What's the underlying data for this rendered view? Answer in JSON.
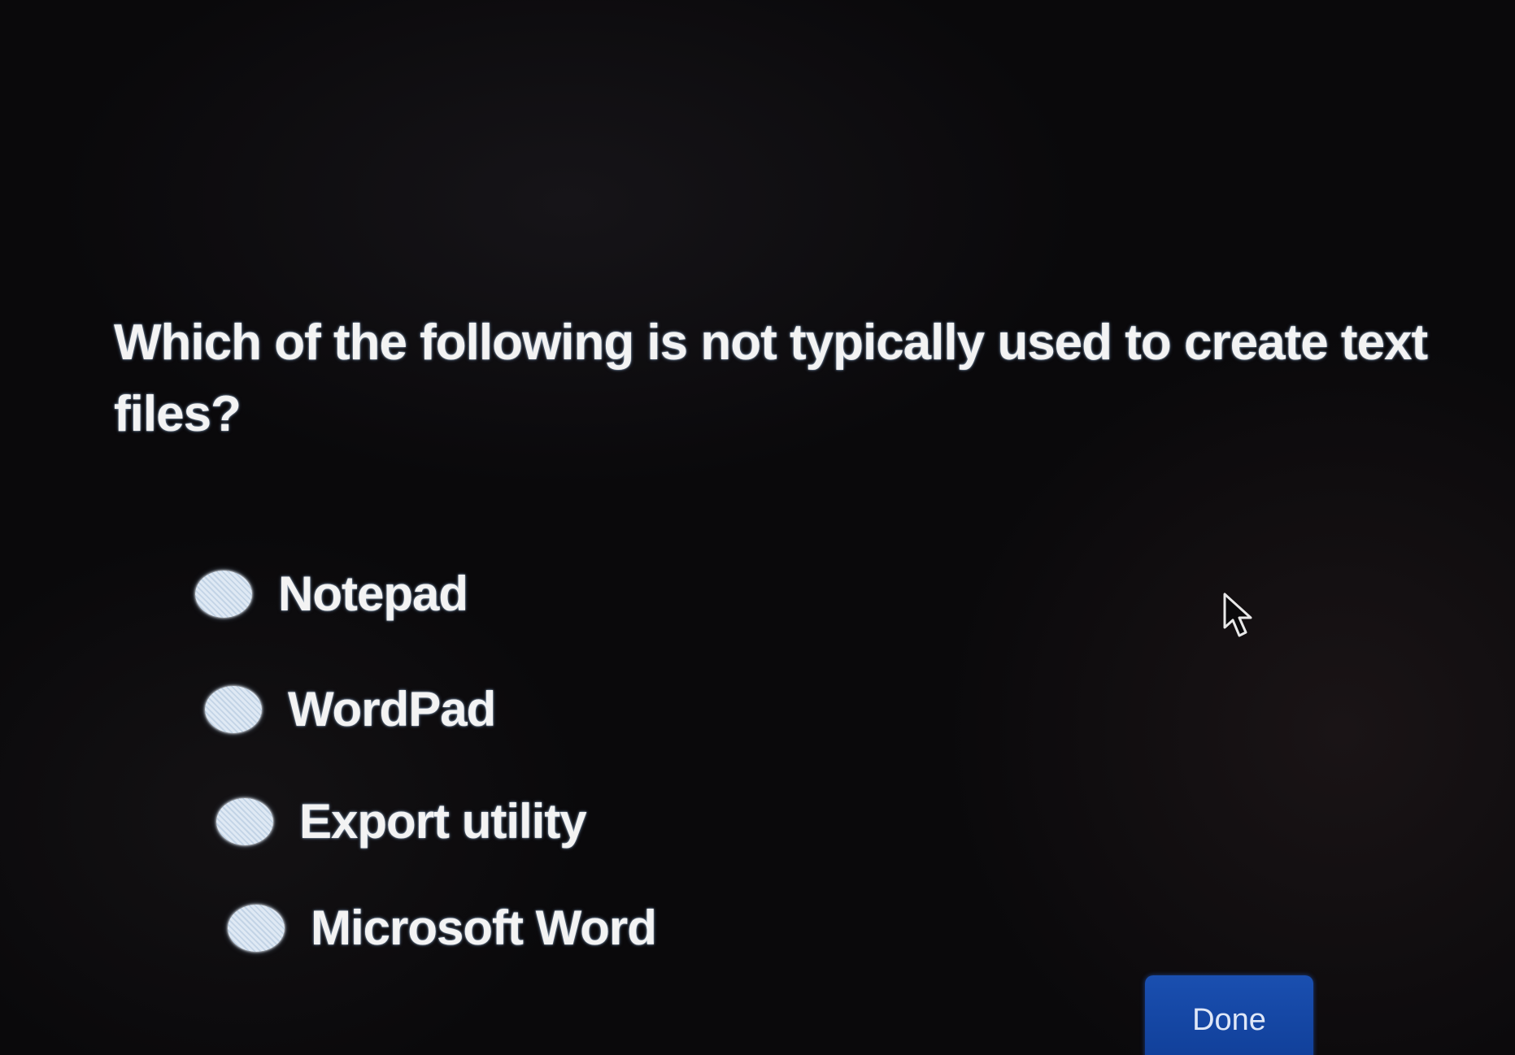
{
  "quiz": {
    "question": "Which of the following is not typically used to create text files?",
    "options": [
      {
        "label": "Notepad",
        "selected": false
      },
      {
        "label": "WordPad",
        "selected": false
      },
      {
        "label": "Export utility",
        "selected": false
      },
      {
        "label": "Microsoft Word",
        "selected": false
      }
    ],
    "done_label": "Done"
  },
  "icons": {
    "cursor": "mouse-pointer-icon"
  },
  "colors": {
    "background": "#0a090b",
    "text": "#f3f3f3",
    "radio_fill": "#dfe9f4",
    "done_button": "#1a4fb0"
  }
}
